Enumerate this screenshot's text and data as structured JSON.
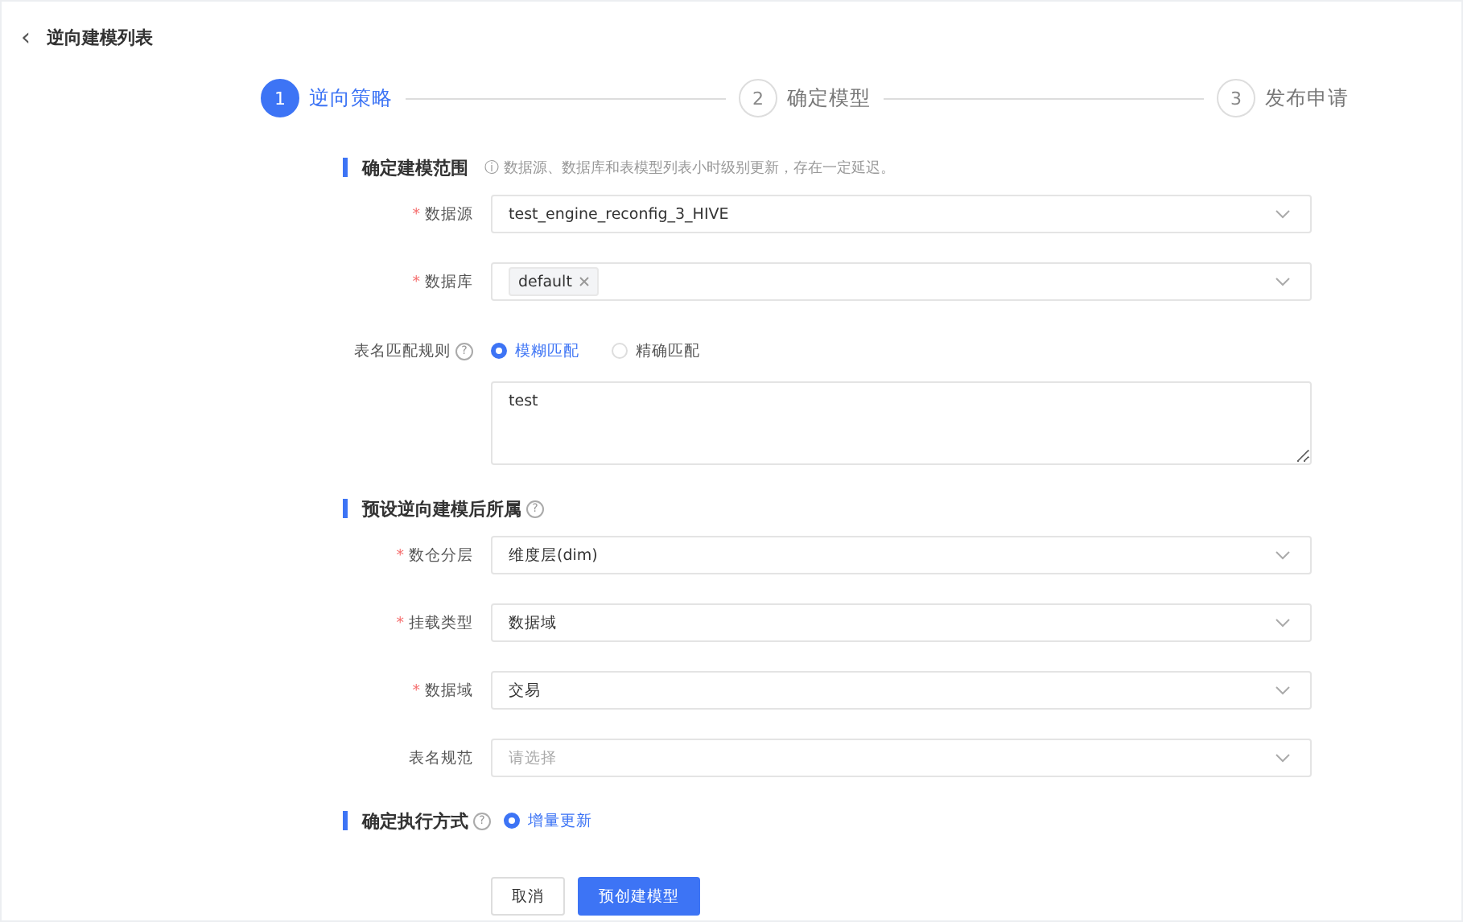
{
  "header": {
    "back_icon": "‹",
    "title": "逆向建模列表"
  },
  "steps": [
    {
      "number": "1",
      "label": "逆向策略",
      "selected": true
    },
    {
      "number": "2",
      "label": "确定模型",
      "selected": false
    },
    {
      "number": "3",
      "label": "发布申请",
      "selected": false
    }
  ],
  "sections": [
    {
      "title": "确定建模范围",
      "note": "ⓘ 数据源、数据库和表模型列表小时级别更新，存在一定延迟。",
      "rows": [
        {
          "kind": "select",
          "label": "数据源",
          "required_mark": "*",
          "value": "test_engine_reconfig_3_HIVE"
        },
        {
          "kind": "tags",
          "label": "数据库",
          "required_mark": "*",
          "tags": [
            "default"
          ]
        },
        {
          "kind": "radio",
          "label": "表名匹配规则",
          "help_icon": "?",
          "options": [
            {
              "label": "模糊匹配",
              "selected": true
            },
            {
              "label": "精确匹配",
              "selected": false
            }
          ]
        },
        {
          "kind": "textarea",
          "value": "test"
        }
      ]
    },
    {
      "title": "预设逆向建模后所属",
      "help_icon": "?",
      "rows": [
        {
          "kind": "select",
          "label": "数仓分层",
          "required_mark": "*",
          "value": "维度层(dim)"
        },
        {
          "kind": "select",
          "label": "挂载类型",
          "required_mark": "*",
          "value": "数据域"
        },
        {
          "kind": "select",
          "label": "数据域",
          "required_mark": "*",
          "value": "交易"
        },
        {
          "kind": "select",
          "label": "表名规范",
          "placeholder": "请选择"
        }
      ]
    },
    {
      "title": "确定执行方式",
      "help_icon": "?",
      "options": [
        {
          "label": "增量更新",
          "selected": true
        }
      ]
    }
  ],
  "buttons": [
    {
      "label": "取消",
      "kind": "default"
    },
    {
      "label": "预创建模型",
      "kind": "primary"
    }
  ]
}
